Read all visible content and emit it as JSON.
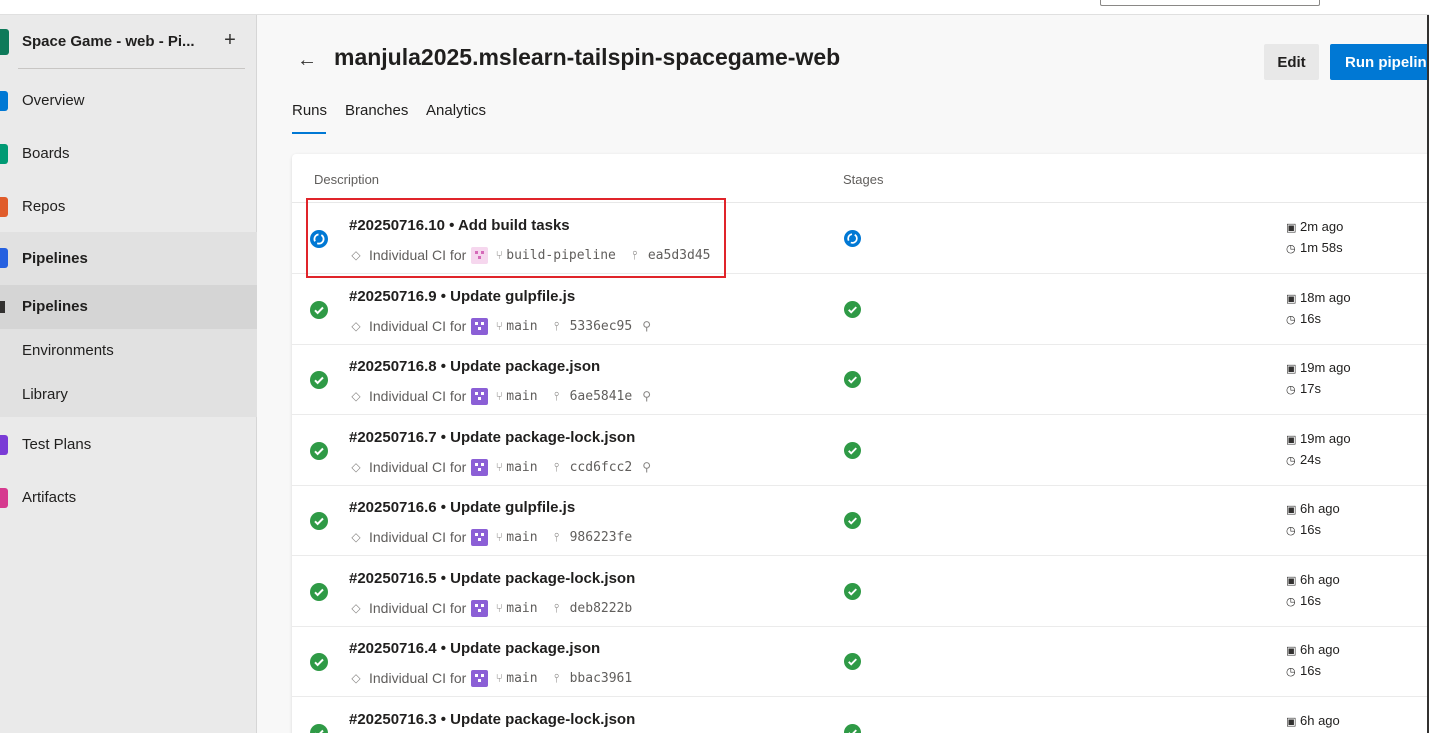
{
  "sidebar": {
    "project_name": "Space Game - web - Pi...",
    "add_symbol": "+",
    "items": [
      {
        "label": "Overview",
        "color": "#0078d4"
      },
      {
        "label": "Boards",
        "color": "#009a74"
      },
      {
        "label": "Repos",
        "color": "#e05c2b"
      },
      {
        "label": "Pipelines",
        "color": "#2560e0"
      },
      {
        "label": "Pipelines",
        "color": "#323130"
      },
      {
        "label": "Environments",
        "color": "#323130"
      },
      {
        "label": "Library",
        "color": "#323130"
      },
      {
        "label": "Test Plans",
        "color": "#7a3bd6"
      },
      {
        "label": "Artifacts",
        "color": "#d63a8f"
      }
    ]
  },
  "header": {
    "back_symbol": "←",
    "title": "manjula2025.mslearn-tailspin-spacegame-web",
    "edit_label": "Edit",
    "run_label": "Run pipeline"
  },
  "tabs": [
    "Runs",
    "Branches",
    "Analytics"
  ],
  "table": {
    "col_description": "Description",
    "col_stages": "Stages",
    "rows": [
      {
        "title": "#20250716.10 • Add build tasks",
        "trigger": "Individual CI for",
        "branch": "build-pipeline",
        "commit": "ea5d3d45",
        "when": "2m ago",
        "duration": "1m 58s",
        "status": "running",
        "pinned": false
      },
      {
        "title": "#20250716.9 • Update gulpfile.js",
        "trigger": "Individual CI for",
        "branch": "main",
        "commit": "5336ec95",
        "when": "18m ago",
        "duration": "16s",
        "status": "succeeded",
        "pinned": true
      },
      {
        "title": "#20250716.8 • Update package.json",
        "trigger": "Individual CI for",
        "branch": "main",
        "commit": "6ae5841e",
        "when": "19m ago",
        "duration": "17s",
        "status": "succeeded",
        "pinned": true
      },
      {
        "title": "#20250716.7 • Update package-lock.json",
        "trigger": "Individual CI for",
        "branch": "main",
        "commit": "ccd6fcc2",
        "when": "19m ago",
        "duration": "24s",
        "status": "succeeded",
        "pinned": true
      },
      {
        "title": "#20250716.6 • Update gulpfile.js",
        "trigger": "Individual CI for",
        "branch": "main",
        "commit": "986223fe",
        "when": "6h ago",
        "duration": "16s",
        "status": "succeeded",
        "pinned": false
      },
      {
        "title": "#20250716.5 • Update package-lock.json",
        "trigger": "Individual CI for",
        "branch": "main",
        "commit": "deb8222b",
        "when": "6h ago",
        "duration": "16s",
        "status": "succeeded",
        "pinned": false
      },
      {
        "title": "#20250716.4 • Update package.json",
        "trigger": "Individual CI for",
        "branch": "main",
        "commit": "bbac3961",
        "when": "6h ago",
        "duration": "16s",
        "status": "succeeded",
        "pinned": false
      },
      {
        "title": "#20250716.3 • Update package-lock.json",
        "trigger": "",
        "branch": "",
        "commit": "",
        "when": "6h ago",
        "duration": "",
        "status": "succeeded",
        "pinned": false
      }
    ]
  },
  "colors": {
    "accent": "#0078d4",
    "success": "#2f9a46",
    "highlight": "#e0242a"
  }
}
